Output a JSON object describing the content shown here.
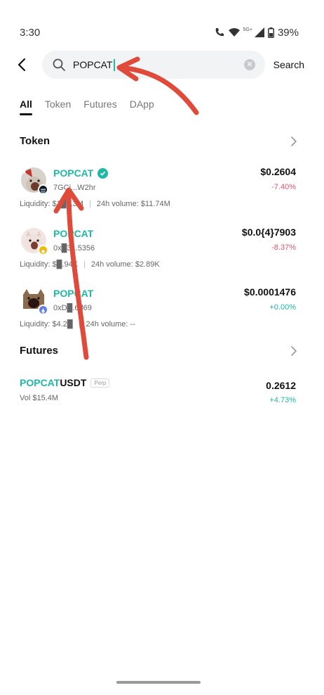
{
  "status": {
    "time": "3:30",
    "network": "5G+",
    "battery": "39%"
  },
  "search": {
    "query": "POPCAT",
    "button": "Search"
  },
  "tabs": [
    "All",
    "Token",
    "Futures",
    "DApp"
  ],
  "token_section": {
    "title": "Token",
    "items": [
      {
        "name": "POPCAT",
        "address": "7GCi...W2hr",
        "liquidity": "Liquidity: $1█.13M",
        "volume": "24h volume: $11.74M",
        "price": "$0.2604",
        "change": "-7.40%",
        "chain": "solana"
      },
      {
        "name": "POPCAT",
        "address": "0x█3...5356",
        "liquidity": "Liquidity: $█.94K",
        "volume": "24h volume: $2.89K",
        "price": "$0.0{4}7903",
        "change": "-8.37%",
        "chain": "bnb"
      },
      {
        "name": "POPCAT",
        "address": "0xD█.6d69",
        "liquidity": "Liquidity: $4.2█",
        "volume": "24h volume: --",
        "price": "$0.0001476",
        "change": "+0.00%",
        "chain": "ethereum"
      }
    ]
  },
  "futures_section": {
    "title": "Futures",
    "items": [
      {
        "base": "POPCAT",
        "quote": "USDT",
        "tag": "Perp",
        "volume": "Vol $15.4M",
        "price": "0.2612",
        "change": "+4.73%"
      }
    ]
  },
  "colors": {
    "accent": "#20b7a6",
    "negative": "#e0526a",
    "annotation": "#e04a3a"
  }
}
